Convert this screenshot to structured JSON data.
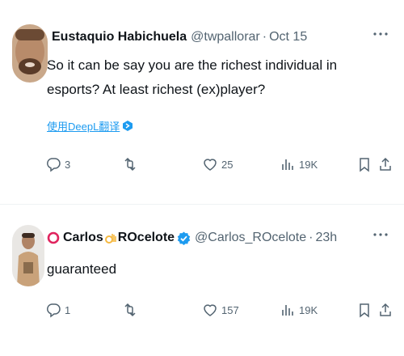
{
  "tweets": [
    {
      "author_name": "Eustaquio Habichuela",
      "handle": "@twpallorar",
      "separator": "·",
      "time": "Oct 15",
      "text": "So it can be say you are the richest individual in esports? At least richest (ex)player?",
      "translate_label": "使用DeepL翻译",
      "replies": "3",
      "retweets": "",
      "likes": "25",
      "views": "19K"
    },
    {
      "author_name_prefix": "Carlos",
      "author_name_suffix": "ROcelote",
      "handle": "@Carlos_ROcelote",
      "separator": "·",
      "time": "23h",
      "text": "guaranteed",
      "replies": "1",
      "retweets": "",
      "likes": "157",
      "views": "19K"
    }
  ],
  "colors": {
    "accent": "#1d9bf0",
    "muted": "#536471",
    "text": "#0f1419",
    "divider": "#eff3f4",
    "verified": "#1d9bf0",
    "badge_o": "#e0245e"
  },
  "icons": {
    "more": "more-icon",
    "reply": "reply-icon",
    "retweet": "retweet-icon",
    "like": "heart-icon",
    "views": "views-icon",
    "bookmark": "bookmark-icon",
    "share": "share-icon"
  }
}
